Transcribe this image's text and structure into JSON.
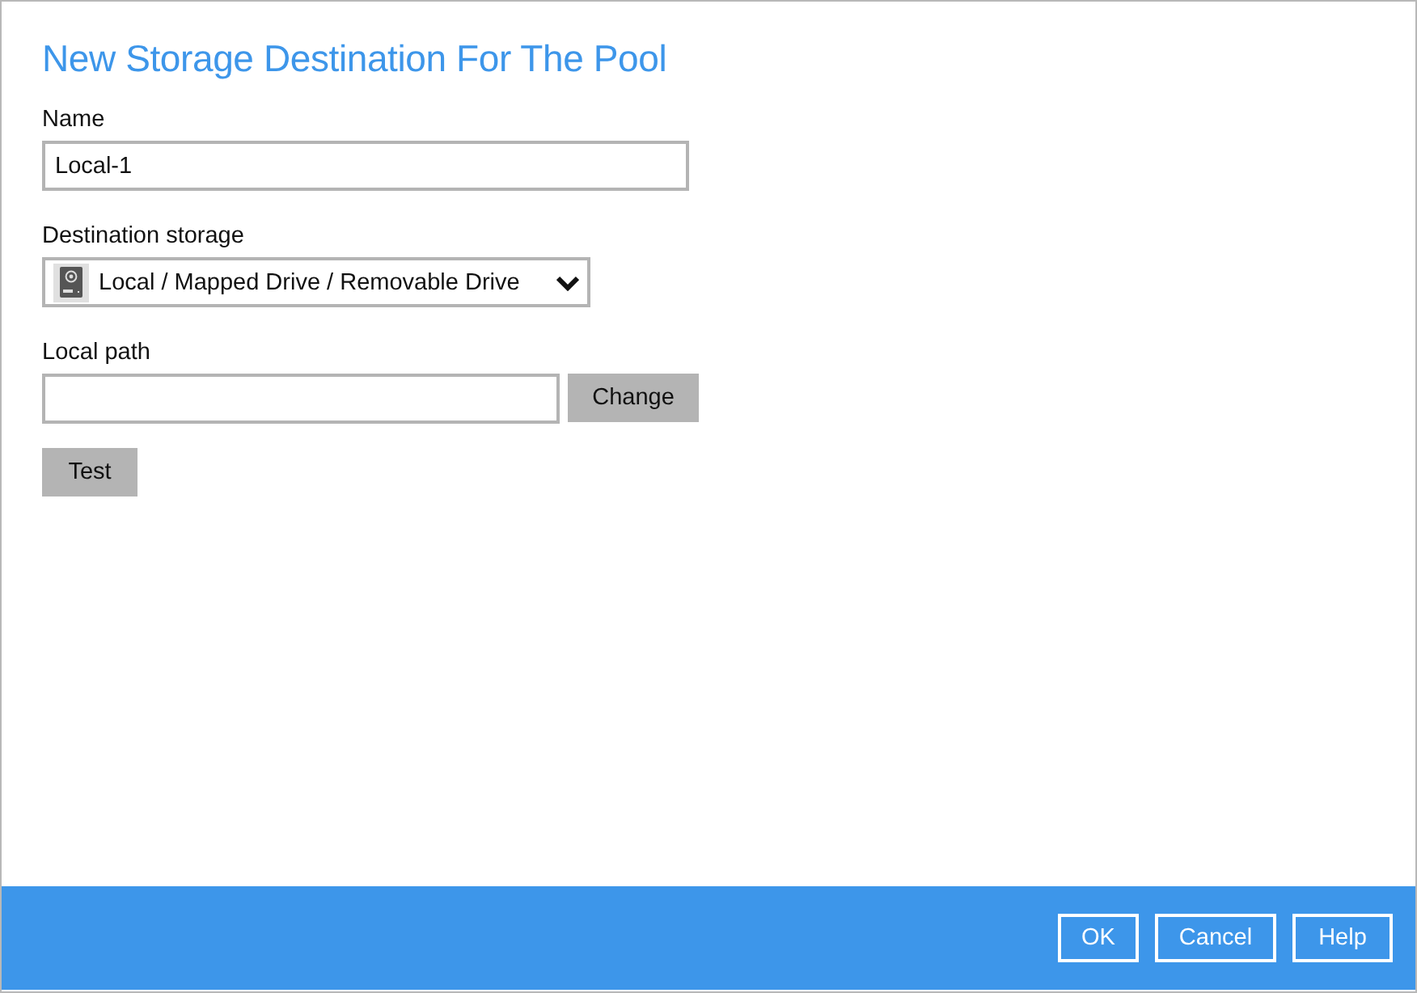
{
  "title": "New Storage Destination For The Pool",
  "name_field": {
    "label": "Name",
    "value": "Local-1"
  },
  "destination_storage": {
    "label": "Destination storage",
    "value": "Local / Mapped Drive / Removable Drive"
  },
  "local_path": {
    "label": "Local path",
    "button": "Change"
  },
  "test_button": "Test",
  "footer_buttons": [
    "OK",
    "Cancel",
    "Help"
  ]
}
